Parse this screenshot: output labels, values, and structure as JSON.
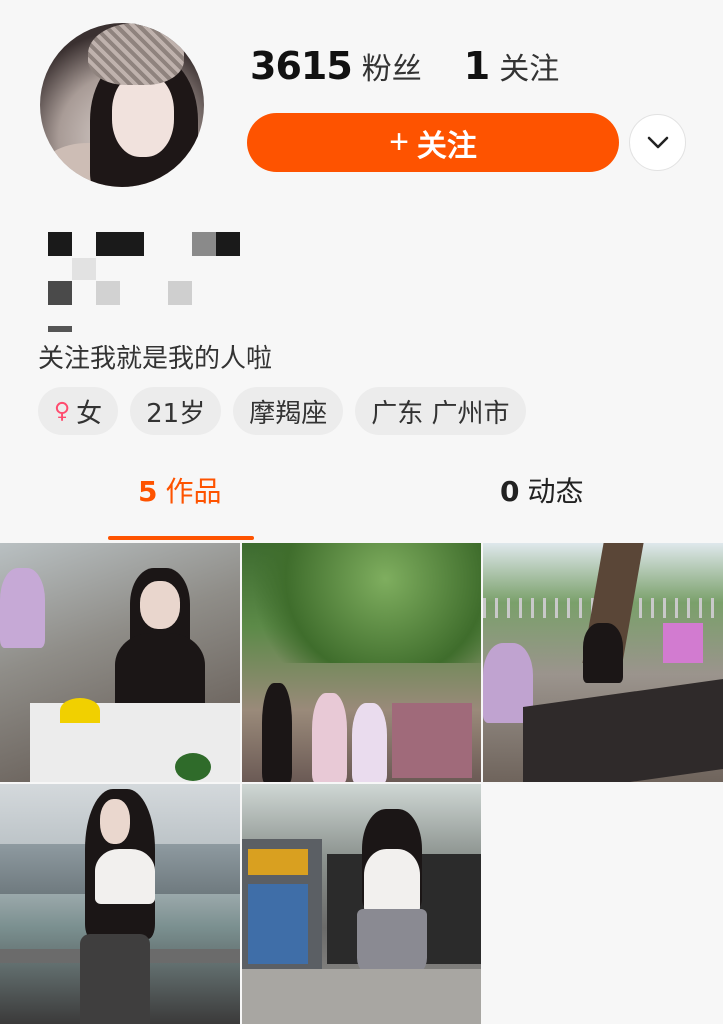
{
  "profile": {
    "followers_count": "3615",
    "followers_label": "粉丝",
    "following_count": "1",
    "following_label": "关注",
    "follow_button": "关注",
    "bio": "关注我就是我的人啦",
    "tags": [
      {
        "icon": "female-icon",
        "label": "女"
      },
      {
        "label": "21岁"
      },
      {
        "label": "摩羯座"
      },
      {
        "label": "广东 广州市"
      }
    ]
  },
  "tabs": [
    {
      "count": "5",
      "label": "作品",
      "active": true
    },
    {
      "count": "0",
      "label": "动态",
      "active": false
    }
  ],
  "colors": {
    "accent": "#fe5300",
    "background": "#f7f7f7",
    "female": "#ff4b6e"
  }
}
